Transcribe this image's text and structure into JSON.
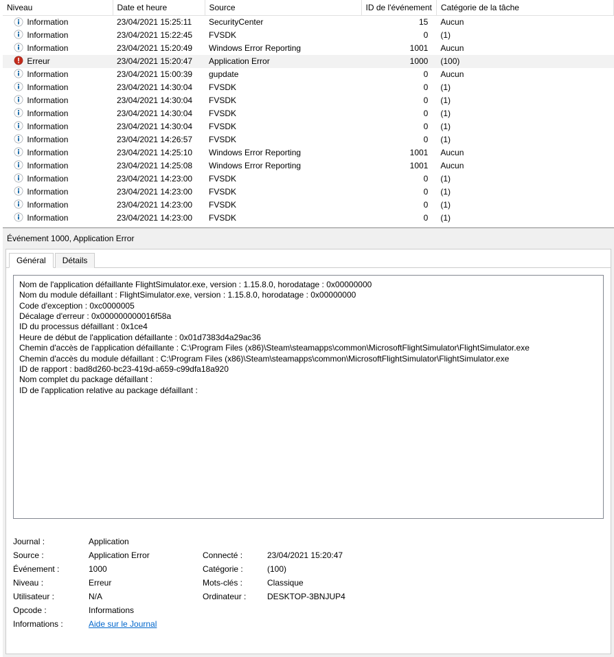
{
  "columns": {
    "level": "Niveau",
    "datetime": "Date et heure",
    "source": "Source",
    "eventid": "ID de l'événement",
    "category": "Catégorie de la tâche"
  },
  "rows": [
    {
      "level": "Information",
      "dt": "23/04/2021 15:25:11",
      "src": "SecurityCenter",
      "id": "15",
      "cat": "Aucun",
      "type": "info"
    },
    {
      "level": "Information",
      "dt": "23/04/2021 15:22:45",
      "src": "FVSDK",
      "id": "0",
      "cat": "(1)",
      "type": "info"
    },
    {
      "level": "Information",
      "dt": "23/04/2021 15:20:49",
      "src": "Windows Error Reporting",
      "id": "1001",
      "cat": "Aucun",
      "type": "info"
    },
    {
      "level": "Erreur",
      "dt": "23/04/2021 15:20:47",
      "src": "Application Error",
      "id": "1000",
      "cat": "(100)",
      "type": "error",
      "selected": true
    },
    {
      "level": "Information",
      "dt": "23/04/2021 15:00:39",
      "src": "gupdate",
      "id": "0",
      "cat": "Aucun",
      "type": "info"
    },
    {
      "level": "Information",
      "dt": "23/04/2021 14:30:04",
      "src": "FVSDK",
      "id": "0",
      "cat": "(1)",
      "type": "info"
    },
    {
      "level": "Information",
      "dt": "23/04/2021 14:30:04",
      "src": "FVSDK",
      "id": "0",
      "cat": "(1)",
      "type": "info"
    },
    {
      "level": "Information",
      "dt": "23/04/2021 14:30:04",
      "src": "FVSDK",
      "id": "0",
      "cat": "(1)",
      "type": "info"
    },
    {
      "level": "Information",
      "dt": "23/04/2021 14:30:04",
      "src": "FVSDK",
      "id": "0",
      "cat": "(1)",
      "type": "info"
    },
    {
      "level": "Information",
      "dt": "23/04/2021 14:26:57",
      "src": "FVSDK",
      "id": "0",
      "cat": "(1)",
      "type": "info"
    },
    {
      "level": "Information",
      "dt": "23/04/2021 14:25:10",
      "src": "Windows Error Reporting",
      "id": "1001",
      "cat": "Aucun",
      "type": "info"
    },
    {
      "level": "Information",
      "dt": "23/04/2021 14:25:08",
      "src": "Windows Error Reporting",
      "id": "1001",
      "cat": "Aucun",
      "type": "info"
    },
    {
      "level": "Information",
      "dt": "23/04/2021 14:23:00",
      "src": "FVSDK",
      "id": "0",
      "cat": "(1)",
      "type": "info"
    },
    {
      "level": "Information",
      "dt": "23/04/2021 14:23:00",
      "src": "FVSDK",
      "id": "0",
      "cat": "(1)",
      "type": "info"
    },
    {
      "level": "Information",
      "dt": "23/04/2021 14:23:00",
      "src": "FVSDK",
      "id": "0",
      "cat": "(1)",
      "type": "info"
    },
    {
      "level": "Information",
      "dt": "23/04/2021 14:23:00",
      "src": "FVSDK",
      "id": "0",
      "cat": "(1)",
      "type": "info"
    }
  ],
  "detail": {
    "title": "Événement 1000, Application Error",
    "tabs": {
      "general": "Général",
      "details": "Détails"
    },
    "description_lines": [
      "Nom de l'application défaillante FlightSimulator.exe, version : 1.15.8.0, horodatage : 0x00000000",
      "Nom du module défaillant : FlightSimulator.exe, version : 1.15.8.0, horodatage : 0x00000000",
      "Code d'exception : 0xc0000005",
      "Décalage d'erreur : 0x000000000016f58a",
      "ID du processus défaillant : 0x1ce4",
      "Heure de début de l'application défaillante : 0x01d7383d4a29ac36",
      "Chemin d'accès de l'application défaillante : C:\\Program Files (x86)\\Steam\\steamapps\\common\\MicrosoftFlightSimulator\\FlightSimulator.exe",
      "Chemin d'accès du module défaillant : C:\\Program Files (x86)\\Steam\\steamapps\\common\\MicrosoftFlightSimulator\\FlightSimulator.exe",
      "ID de rapport : bad8d260-bc23-419d-a659-c99dfa18a920",
      "Nom complet du package défaillant :",
      "ID de l'application relative au package défaillant :"
    ],
    "fields": {
      "journal_label": "Journal :",
      "journal_value": "Application",
      "source_label": "Source :",
      "source_value": "Application Error",
      "connected_label": "Connecté :",
      "connected_value": "23/04/2021 15:20:47",
      "event_label": "Événement :",
      "event_value": "1000",
      "category_label": "Catégorie :",
      "category_value": "(100)",
      "level_label": "Niveau :",
      "level_value": "Erreur",
      "keywords_label": "Mots-clés :",
      "keywords_value": "Classique",
      "user_label": "Utilisateur :",
      "user_value": "N/A",
      "computer_label": "Ordinateur :",
      "computer_value": "DESKTOP-3BNJUP4",
      "opcode_label": "Opcode :",
      "opcode_value": "Informations",
      "info_label": "Informations :",
      "info_link": "Aide sur le Journal"
    }
  }
}
